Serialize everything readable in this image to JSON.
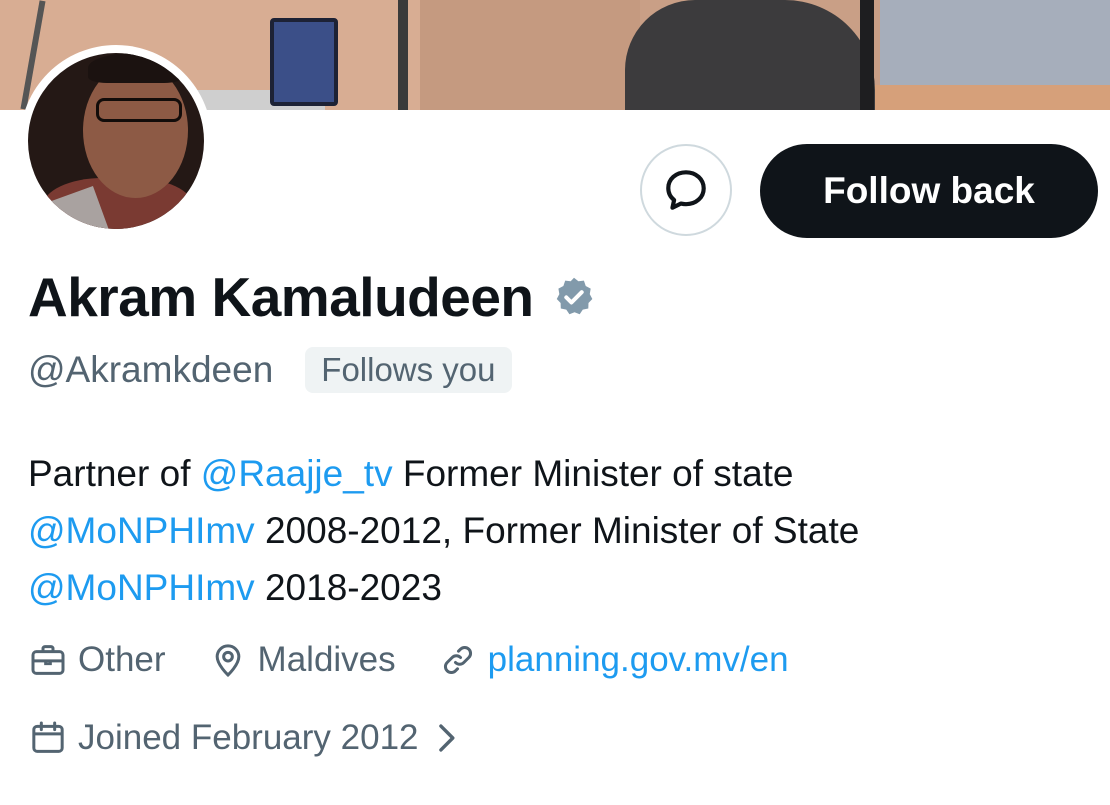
{
  "profile": {
    "name": "Akram Kamaludeen",
    "handle": "@Akramkdeen",
    "follows_you": "Follows you",
    "verified_icon": "verified-badge-icon",
    "bio": {
      "line1": [
        {
          "text": "Partner of ",
          "type": "text"
        },
        {
          "text": "@Raajje_tv",
          "type": "mention"
        },
        {
          "text": " Former Minister of state",
          "type": "text"
        }
      ],
      "line2": [
        {
          "text": "@MoNPHImv",
          "type": "mention"
        },
        {
          "text": " 2008-2012, Former Minister of State",
          "type": "text"
        }
      ],
      "line3": [
        {
          "text": "@MoNPHImv",
          "type": "mention"
        },
        {
          "text": " 2018-2023",
          "type": "text"
        }
      ]
    },
    "category": "Other",
    "location": "Maldives",
    "website": "planning.gov.mv/en",
    "joined": "Joined February 2012"
  },
  "actions": {
    "message_icon": "message-bubble-icon",
    "follow_back_label": "Follow back"
  },
  "colors": {
    "accent": "#1d9bf0",
    "text": "#0f1419",
    "muted": "#536471",
    "verified": "#829aab",
    "button_dark": "#0f1419"
  }
}
